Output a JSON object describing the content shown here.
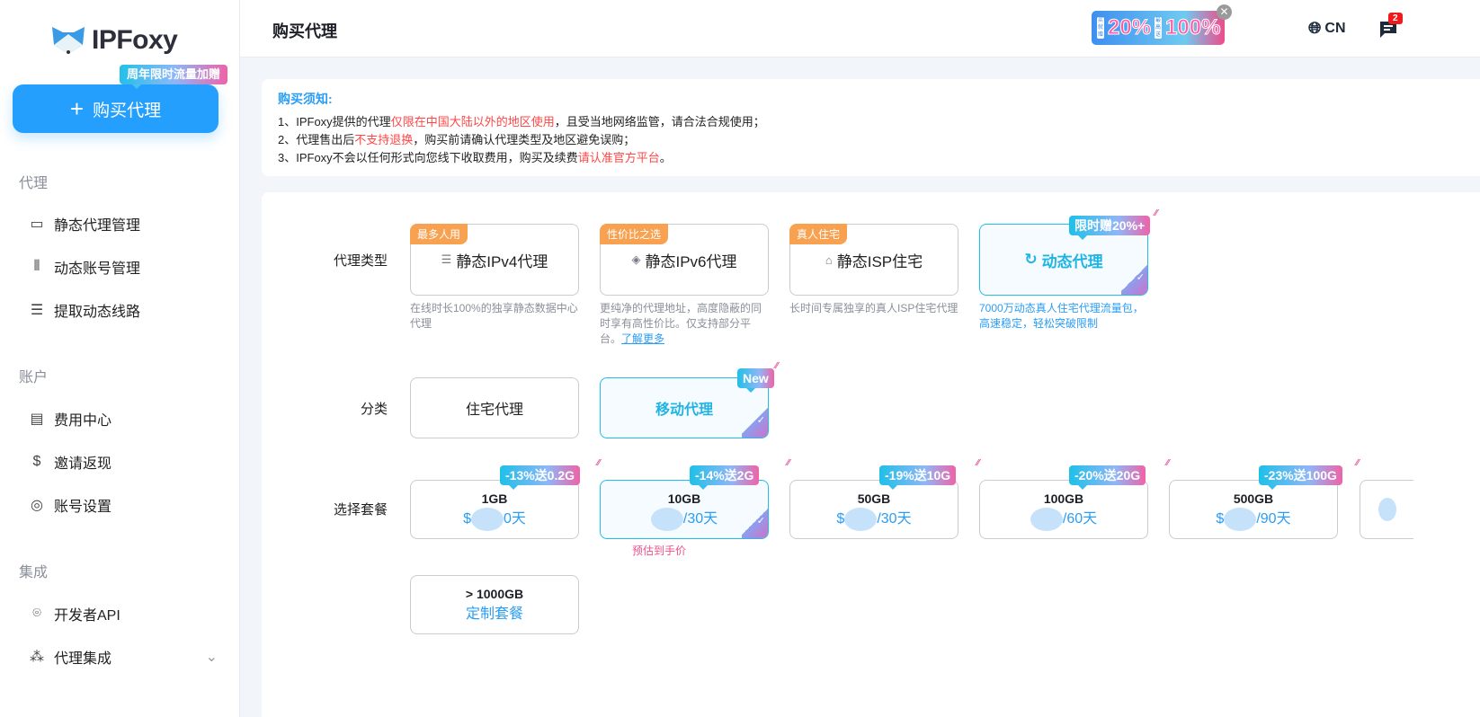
{
  "sidebar": {
    "logo_text": "IPFoxy",
    "promo_tag": "周年限时流量加赠",
    "buy_button": "购买代理",
    "sections": [
      {
        "label": "代理",
        "items": [
          {
            "label": "静态代理管理",
            "icon": "monitor-icon"
          },
          {
            "label": "动态账号管理",
            "icon": "accounts-icon"
          },
          {
            "label": "提取动态线路",
            "icon": "server-icon"
          }
        ]
      },
      {
        "label": "账户",
        "items": [
          {
            "label": "费用中心",
            "icon": "card-icon"
          },
          {
            "label": "邀请返现",
            "icon": "dollar-icon"
          },
          {
            "label": "账号设置",
            "icon": "user-icon"
          }
        ]
      },
      {
        "label": "集成",
        "items": [
          {
            "label": "开发者API",
            "icon": "fingerprint-icon"
          },
          {
            "label": "代理集成",
            "icon": "integration-icon"
          }
        ]
      }
    ]
  },
  "header": {
    "title": "购买代理",
    "banner": {
      "left_small": "买就赠",
      "left_big": "20%",
      "left_plus": "+",
      "right_small": "最高送",
      "right_big": "100%"
    },
    "language": "CN",
    "message_count": "2"
  },
  "notice": {
    "title": "购买须知:",
    "lines": [
      {
        "a": "1、IPFoxy提供的代理",
        "red": "仅限在中国大陆以外的地区使用",
        "b": "，且受当地网络监管，请合法合规使用；"
      },
      {
        "a": "2、代理售出后",
        "red": "不支持退换",
        "b": "，购买前请确认代理类型及地区避免误购；"
      },
      {
        "a": "3、IPFoxy不会以任何形式向您线下收取费用，购买及续费",
        "red": "请认准官方平台",
        "b": "。"
      }
    ]
  },
  "proxy_type": {
    "label": "代理类型",
    "options": [
      {
        "tag": "最多人用",
        "title": "静态IPv4代理",
        "icon": "server-icon",
        "desc": "在线时长100%的独享静态数据中心代理"
      },
      {
        "tag": "性价比之选",
        "title": "静态IPv6代理",
        "icon": "layers-icon",
        "desc": "更纯净的代理地址，高度隐蔽的同时享有高性价比。仅支持部分平台。",
        "link": "了解更多"
      },
      {
        "tag": "真人住宅",
        "title": "静态ISP住宅",
        "icon": "home-icon",
        "desc": "长时间专属独享的真人ISP住宅代理"
      },
      {
        "promo": "限时赠20%+",
        "title": "动态代理",
        "icon": "refresh-icon",
        "desc": "7000万动态真人住宅代理流量包，高速稳定，轻松突破限制",
        "selected": true
      }
    ]
  },
  "category": {
    "label": "分类",
    "options": [
      {
        "title": "住宅代理"
      },
      {
        "title": "移动代理",
        "promo": "New",
        "selected": true
      }
    ]
  },
  "package": {
    "label": "选择套餐",
    "options": [
      {
        "promo": "-13%送0.2G",
        "size": "1GB",
        "price_prefix": "$",
        "price_suffix": "0天"
      },
      {
        "promo": "-14%送2G",
        "size": "10GB",
        "price_prefix": "",
        "price_suffix": "/30天",
        "selected": true
      },
      {
        "promo": "-19%送10G",
        "size": "50GB",
        "price_prefix": "$",
        "price_suffix": "/30天"
      },
      {
        "promo": "-20%送20G",
        "size": "100GB",
        "price_prefix": "",
        "price_suffix": "/60天"
      },
      {
        "promo": "-23%送100G",
        "size": "500GB",
        "price_prefix": "$",
        "price_suffix": "/90天"
      }
    ],
    "estimate": "预估到手价",
    "custom": {
      "size": "> 1000GB",
      "label": "定制套餐"
    }
  }
}
